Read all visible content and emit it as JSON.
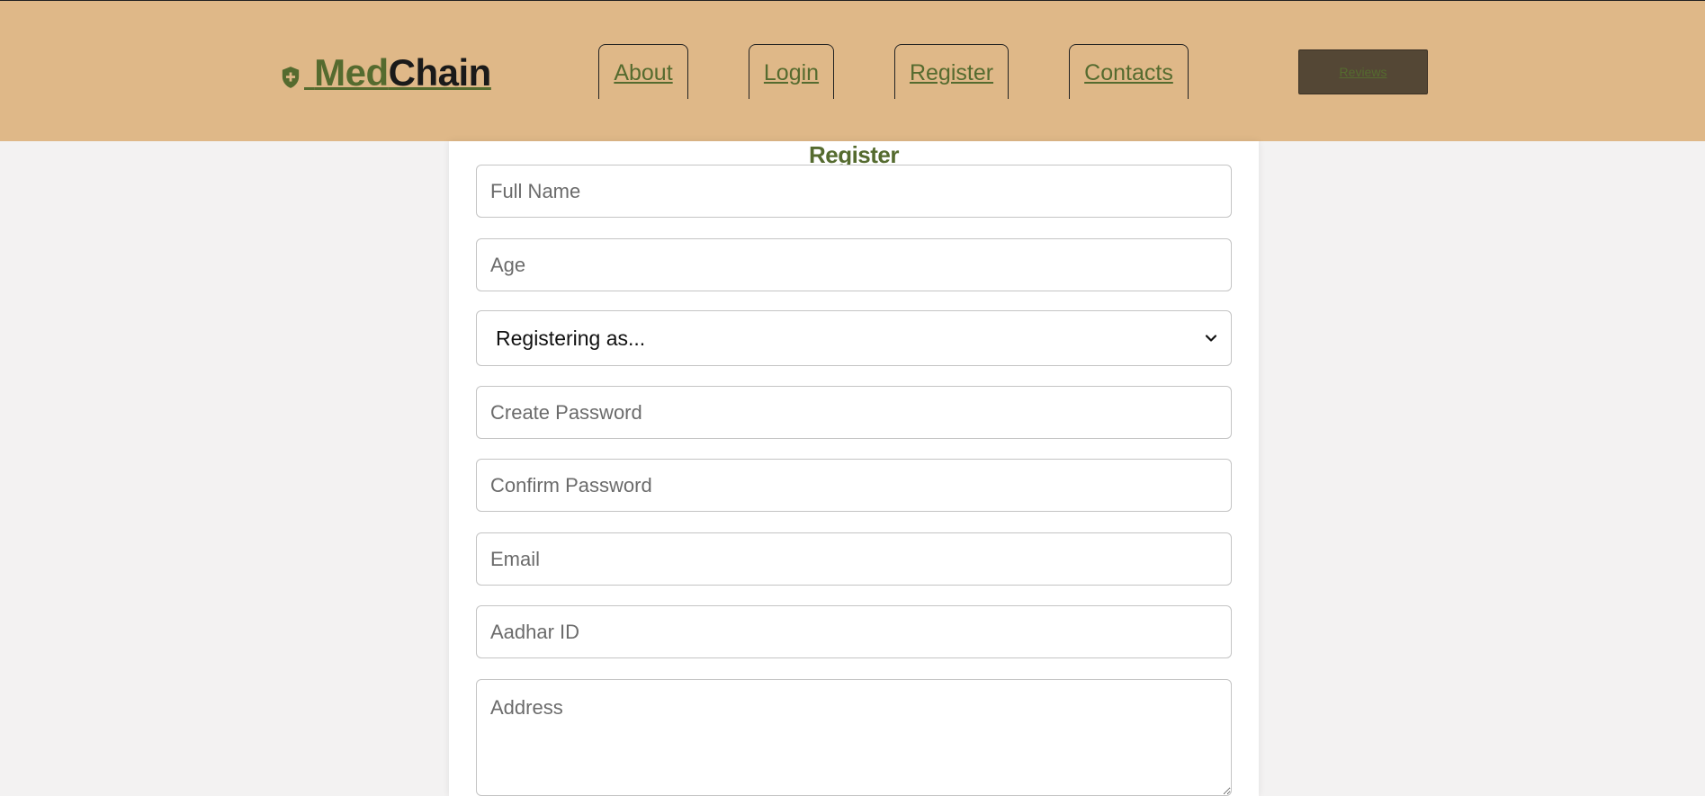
{
  "header": {
    "logo": {
      "part1": "Med",
      "part2": "Chain",
      "icon": "shield-plus-icon"
    },
    "nav": [
      {
        "label": "About"
      },
      {
        "label": "Login"
      },
      {
        "label": "Register"
      },
      {
        "label": "Contacts"
      }
    ],
    "reviews_label": "Reviews"
  },
  "form": {
    "title": "Register",
    "full_name_placeholder": "Full Name",
    "age_placeholder": "Age",
    "role_select": {
      "selected": "Registering as...",
      "icon": "chevron-down-icon"
    },
    "create_password_placeholder": "Create Password",
    "confirm_password_placeholder": "Confirm Password",
    "email_placeholder": "Email",
    "aadhar_placeholder": "Aadhar ID",
    "address_placeholder": "Address"
  },
  "colors": {
    "header_bg": "#dfb888",
    "accent_green": "#556b2f",
    "reviews_bg": "#544735",
    "page_bg": "#f3f2f2"
  }
}
